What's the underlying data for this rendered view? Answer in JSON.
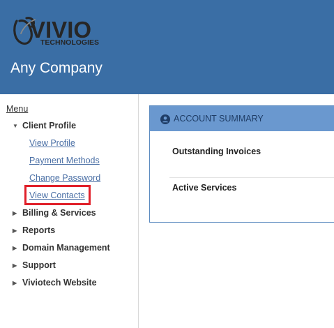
{
  "header": {
    "logo": {
      "main": "VIVIO",
      "sub": "TECHNOLOGIES"
    },
    "company_name": "Any Company",
    "background_color": "#3a6ea5"
  },
  "sidebar": {
    "menu_label": "Menu",
    "items": [
      {
        "label": "Client Profile",
        "expanded": true,
        "icon": "caret-down-icon",
        "children": [
          {
            "label": "View Profile"
          },
          {
            "label": "Payment Methods"
          },
          {
            "label": "Change Password"
          },
          {
            "label": "View Contacts",
            "highlighted": true
          }
        ]
      },
      {
        "label": "Billing & Services",
        "expanded": false,
        "icon": "caret-right-icon"
      },
      {
        "label": "Reports",
        "expanded": false,
        "icon": "caret-right-icon"
      },
      {
        "label": "Domain Management",
        "expanded": false,
        "icon": "caret-right-icon"
      },
      {
        "label": "Support",
        "expanded": false,
        "icon": "caret-right-icon"
      },
      {
        "label": "Viviotech Website",
        "expanded": false,
        "icon": "caret-right-icon"
      }
    ],
    "highlight_color": "#e0202a"
  },
  "account_summary": {
    "title": "ACCOUNT SUMMARY",
    "icon": "user-circle-icon",
    "rows": [
      {
        "label": "Outstanding Invoices"
      },
      {
        "label": "Active Services"
      }
    ],
    "header_color": "#6a98cf"
  }
}
